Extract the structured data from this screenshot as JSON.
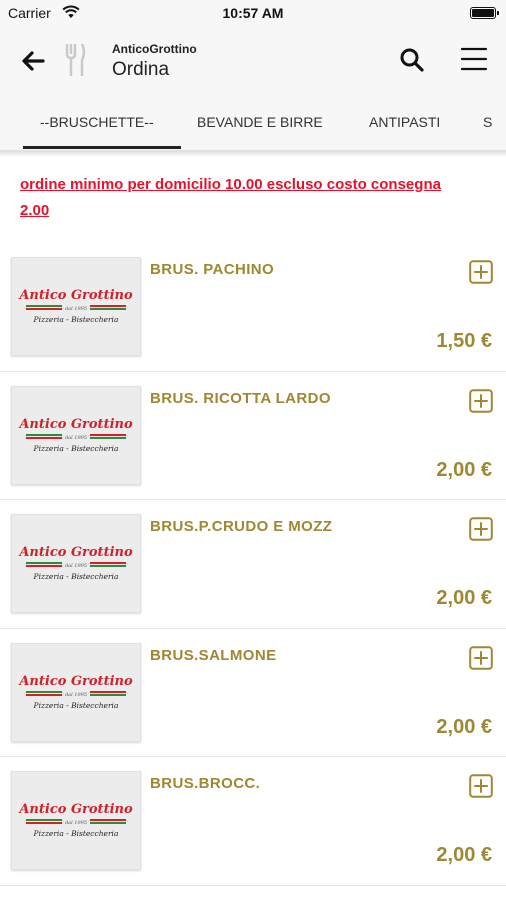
{
  "status_bar": {
    "carrier": "Carrier",
    "time": "10:57 AM"
  },
  "nav": {
    "subtitle": "AnticoGrottino",
    "title": "Ordina"
  },
  "tabs": [
    {
      "label": "--BRUSCHETTE--",
      "selected": true
    },
    {
      "label": "BEVANDE E BIRRE",
      "selected": false
    },
    {
      "label": "ANTIPASTI",
      "selected": false
    },
    {
      "label": "S",
      "selected": false
    }
  ],
  "notice": "ordine minimo per domicilio 10.00 escluso costo consegna 2.00 ",
  "logo": {
    "line1": "Antico Grottino",
    "line2": "dal 1995",
    "line3": "Pizzeria - Bisteccheria"
  },
  "items": [
    {
      "name": "BRUS. PACHINO",
      "price": "1,50 €"
    },
    {
      "name": "BRUS. RICOTTA LARDO",
      "price": "2,00 €"
    },
    {
      "name": "BRUS.P.CRUDO E MOZZ",
      "price": "2,00 €"
    },
    {
      "name": "BRUS.SALMONE",
      "price": "2,00 €"
    },
    {
      "name": "BRUS.BROCC.",
      "price": "2,00 €"
    }
  ],
  "colors": {
    "accent_gold": "#a08732",
    "notice_red": "#e8112d",
    "logo_red": "#d4202a",
    "logo_green": "#2f8a3a"
  },
  "icons": {
    "back": "arrow-left-icon",
    "fork": "fork-knife-icon",
    "search": "search-icon",
    "menu": "hamburger-menu-icon",
    "add": "plus-square-icon"
  }
}
